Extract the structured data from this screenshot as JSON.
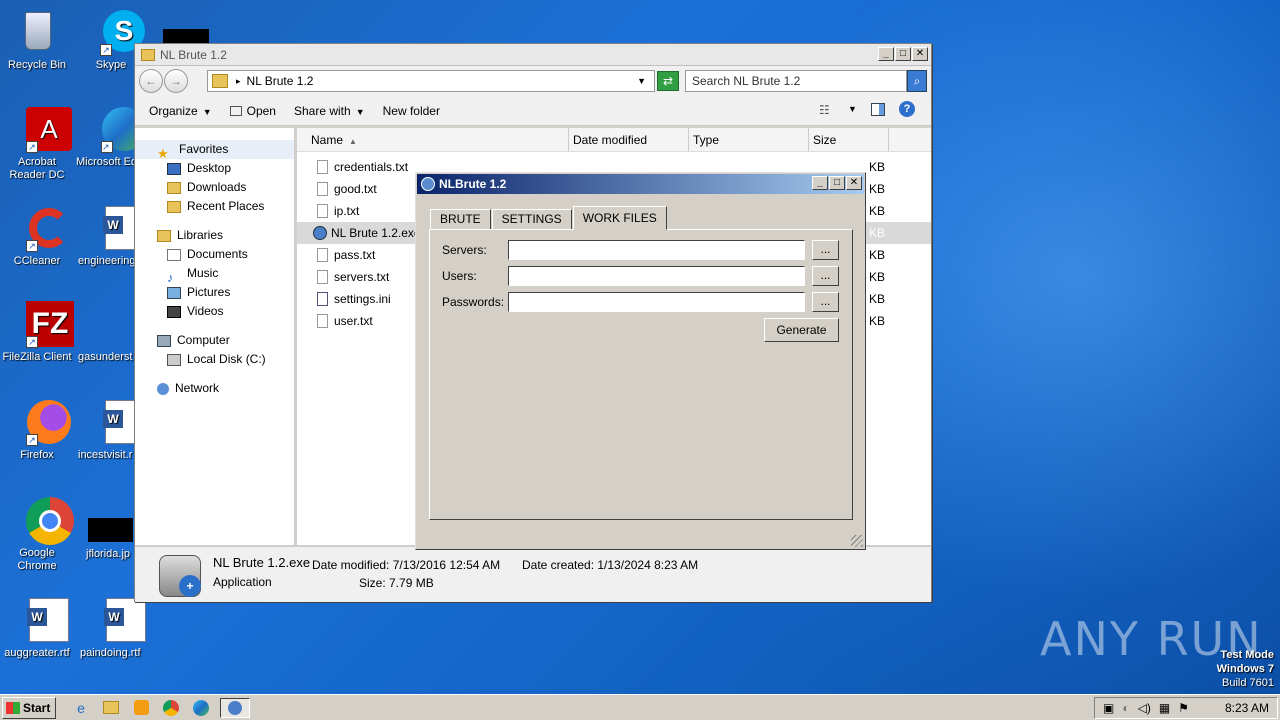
{
  "desktop": {
    "icons": [
      {
        "label": "Recycle Bin"
      },
      {
        "label": "Skype"
      },
      {
        "label": "Acrobat Reader DC"
      },
      {
        "label": "Microsoft Ed"
      },
      {
        "label": "CCleaner"
      },
      {
        "label": "engineering"
      },
      {
        "label": "FileZilla Client"
      },
      {
        "label": "gasunderst"
      },
      {
        "label": "Firefox"
      },
      {
        "label": "incestvisit.r"
      },
      {
        "label": "Google Chrome"
      },
      {
        "label": "jflorida.jp"
      },
      {
        "label": "auggreater.rtf"
      },
      {
        "label": "paindoing.rtf"
      }
    ],
    "watermark": {
      "line1": "Test Mode",
      "line2": "Windows 7",
      "line3": "Build 7601"
    },
    "brand": "ANY RUN"
  },
  "explorer": {
    "title": "NL Brute 1.2",
    "address": "NL Brute 1.2",
    "search_placeholder": "Search NL Brute 1.2",
    "toolbar": {
      "organize": "Organize",
      "open": "Open",
      "share": "Share with",
      "new_folder": "New folder"
    },
    "nav": {
      "favorites": "Favorites",
      "desktop": "Desktop",
      "downloads": "Downloads",
      "recent": "Recent Places",
      "libraries": "Libraries",
      "documents": "Documents",
      "music": "Music",
      "pictures": "Pictures",
      "videos": "Videos",
      "computer": "Computer",
      "local_disk": "Local Disk (C:)",
      "network": "Network"
    },
    "columns": {
      "name": "Name",
      "date": "Date modified",
      "type": "Type",
      "size": "Size"
    },
    "files": [
      {
        "name": "credentials.txt",
        "size": "KB"
      },
      {
        "name": "good.txt",
        "size": "KB"
      },
      {
        "name": "ip.txt",
        "size": "KB"
      },
      {
        "name": "NL Brute 1.2.exe",
        "size": "KB"
      },
      {
        "name": "pass.txt",
        "size": "KB"
      },
      {
        "name": "servers.txt",
        "size": "KB"
      },
      {
        "name": "settings.ini",
        "size": "KB"
      },
      {
        "name": "user.txt",
        "size": "KB"
      }
    ],
    "details": {
      "filename": "NL Brute 1.2.exe",
      "type": "Application",
      "modified": "Date modified: 7/13/2016 12:54 AM",
      "created": "Date created: 1/13/2024 8:23 AM",
      "size": "Size: 7.79 MB"
    }
  },
  "nlbrute": {
    "title": "NLBrute 1.2",
    "tabs": [
      "BRUTE",
      "SETTINGS",
      "WORK FILES"
    ],
    "fields": {
      "servers": "Servers:",
      "users": "Users:",
      "passwords": "Passwords:"
    },
    "browse": "...",
    "generate": "Generate"
  },
  "taskbar": {
    "start": "Start",
    "clock": "8:23 AM"
  }
}
